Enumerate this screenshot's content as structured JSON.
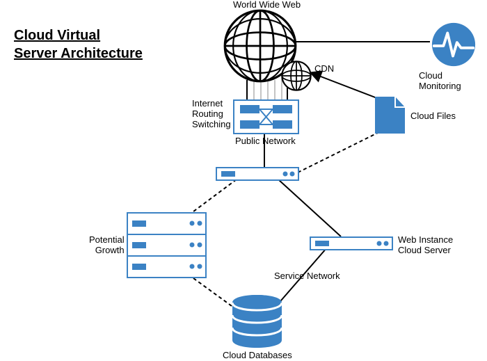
{
  "title": "Cloud Virtual \nServer Architecture",
  "labels": {
    "www": "World Wide Web",
    "cdn": "CDN",
    "internet_routing": "Internet\nRouting\nSwitching",
    "public_network": "Public Network",
    "cloud_monitoring": "Cloud Monitoring",
    "cloud_files": "Cloud Files",
    "potential_growth": "Potential\nGrowth",
    "web_instance": "Web Instance\nCloud Server",
    "service_network": "Service Network",
    "cloud_databases": "Cloud Databases"
  },
  "diagram": {
    "type": "network_architecture",
    "nodes": [
      {
        "id": "www",
        "type": "globe",
        "label": "World Wide Web"
      },
      {
        "id": "cdn",
        "type": "globe_small",
        "label": "CDN"
      },
      {
        "id": "cloud_monitoring",
        "type": "monitor_circle",
        "label": "Cloud Monitoring"
      },
      {
        "id": "switch",
        "type": "switch",
        "label": "Internet Routing Switching / Public Network"
      },
      {
        "id": "cloud_files",
        "type": "file",
        "label": "Cloud Files"
      },
      {
        "id": "load_balancer",
        "type": "server_single",
        "label": ""
      },
      {
        "id": "potential_growth",
        "type": "server_rack",
        "label": "Potential Growth"
      },
      {
        "id": "web_instance",
        "type": "server_single",
        "label": "Web Instance Cloud Server"
      },
      {
        "id": "cloud_databases",
        "type": "database",
        "label": "Cloud Databases"
      }
    ],
    "edges": [
      {
        "from": "www",
        "to": "cloud_monitoring",
        "style": "solid"
      },
      {
        "from": "www",
        "to": "switch",
        "style": "solid_multi"
      },
      {
        "from": "cdn",
        "to": "switch",
        "style": "solid"
      },
      {
        "from": "cloud_files",
        "to": "cdn",
        "style": "solid_arrow"
      },
      {
        "from": "switch",
        "to": "load_balancer",
        "style": "solid"
      },
      {
        "from": "load_balancer",
        "to": "potential_growth",
        "style": "dashed"
      },
      {
        "from": "load_balancer",
        "to": "web_instance",
        "style": "solid"
      },
      {
        "from": "load_balancer",
        "to": "cloud_files",
        "style": "dashed"
      },
      {
        "from": "web_instance",
        "to": "cloud_databases",
        "style": "solid"
      },
      {
        "from": "potential_growth",
        "to": "cloud_databases",
        "style": "dashed"
      }
    ]
  },
  "colors": {
    "brand": "#3b82c4",
    "brand_dark": "#2f6ca8"
  }
}
